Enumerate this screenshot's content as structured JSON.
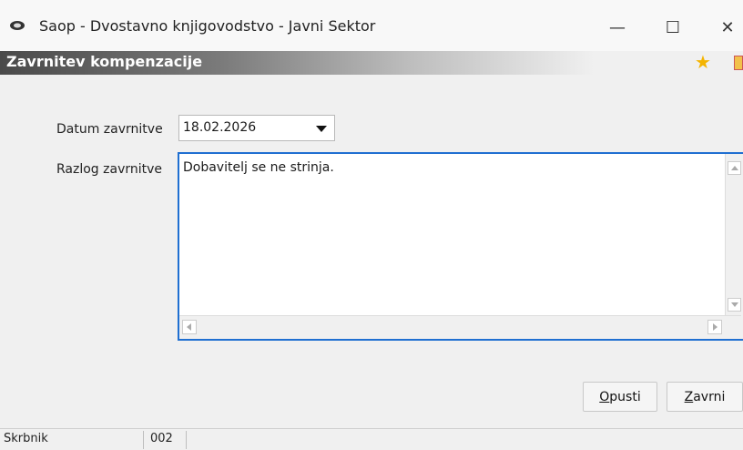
{
  "window": {
    "title": "Saop  - Dvostavno knjigovodstvo - Javni Sektor",
    "minimize_glyph": "—",
    "maximize_glyph": "☐",
    "close_glyph": "✕"
  },
  "panel": {
    "title": "Zavrnitev kompenzacije",
    "icons": [
      "star-icon",
      "toolbar-icon"
    ]
  },
  "form": {
    "date_label": "Datum zavrnitve",
    "date_value": "18.02.2026",
    "reason_label": "Razlog zavrnitve",
    "reason_value": "Dobavitelj se ne strinja."
  },
  "buttons": {
    "cancel_label": "Opusti",
    "reject_label": "Zavrni"
  },
  "statusbar": {
    "user": "Skrbnik",
    "code": "002"
  },
  "colors": {
    "accent": "#1f6fd1",
    "star": "#f4b400"
  }
}
